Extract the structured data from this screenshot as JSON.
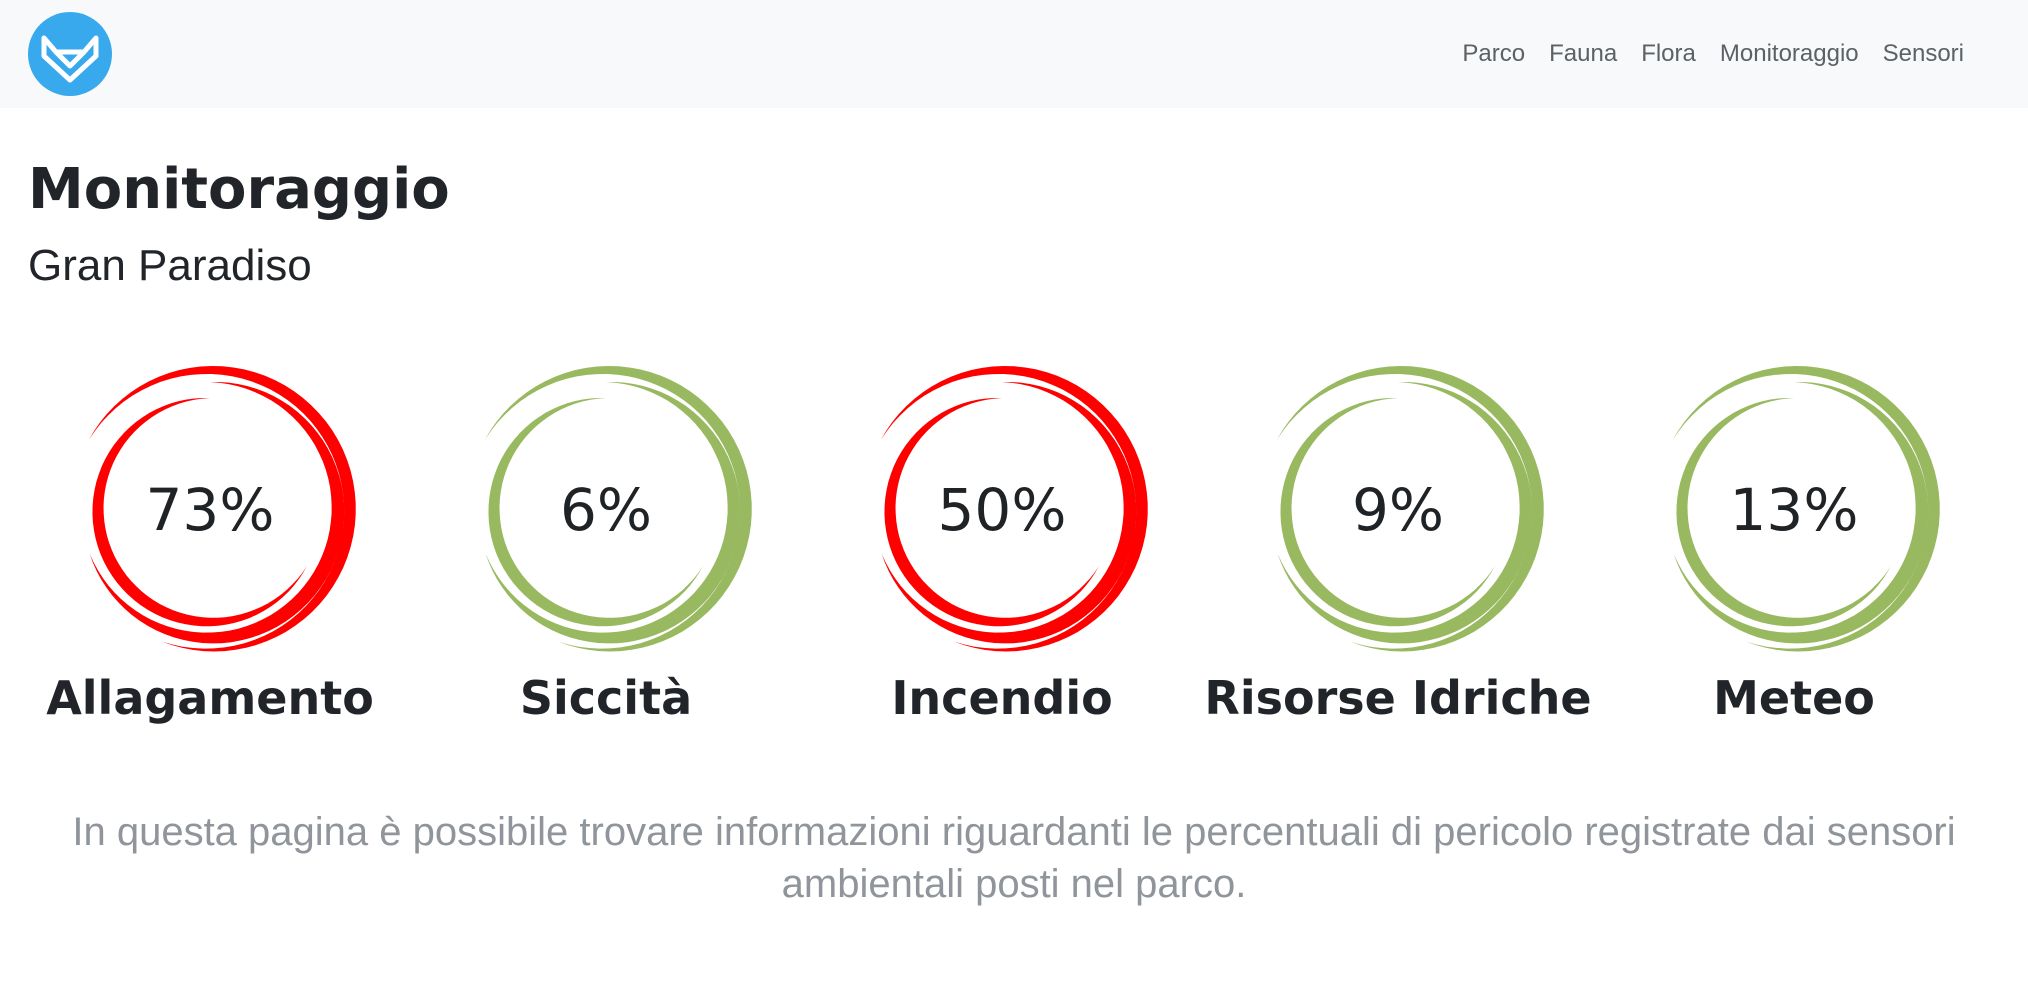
{
  "navbar": {
    "logo_icon": "fox-head-icon",
    "logo_color": "#39a9ee",
    "links": [
      {
        "label": "Parco"
      },
      {
        "label": "Fauna"
      },
      {
        "label": "Flora"
      },
      {
        "label": "Monitoraggio"
      },
      {
        "label": "Sensori"
      }
    ]
  },
  "header": {
    "title": "Monitoraggio",
    "subtitle": "Gran Paradiso"
  },
  "gauges": [
    {
      "label": "Allagamento",
      "value": "73%",
      "level": 73,
      "color": "#ff0000"
    },
    {
      "label": "Siccità",
      "value": "6%",
      "level": 6,
      "color": "#98b960"
    },
    {
      "label": "Incendio",
      "value": "50%",
      "level": 50,
      "color": "#ff0000"
    },
    {
      "label": "Risorse Idriche",
      "value": "9%",
      "level": 9,
      "color": "#98b960"
    },
    {
      "label": "Meteo",
      "value": "13%",
      "level": 13,
      "color": "#98b960"
    }
  ],
  "description": "In questa pagina è possibile trovare informazioni riguardanti le percentuali di pericolo registrate dai sensori ambientali posti nel parco."
}
